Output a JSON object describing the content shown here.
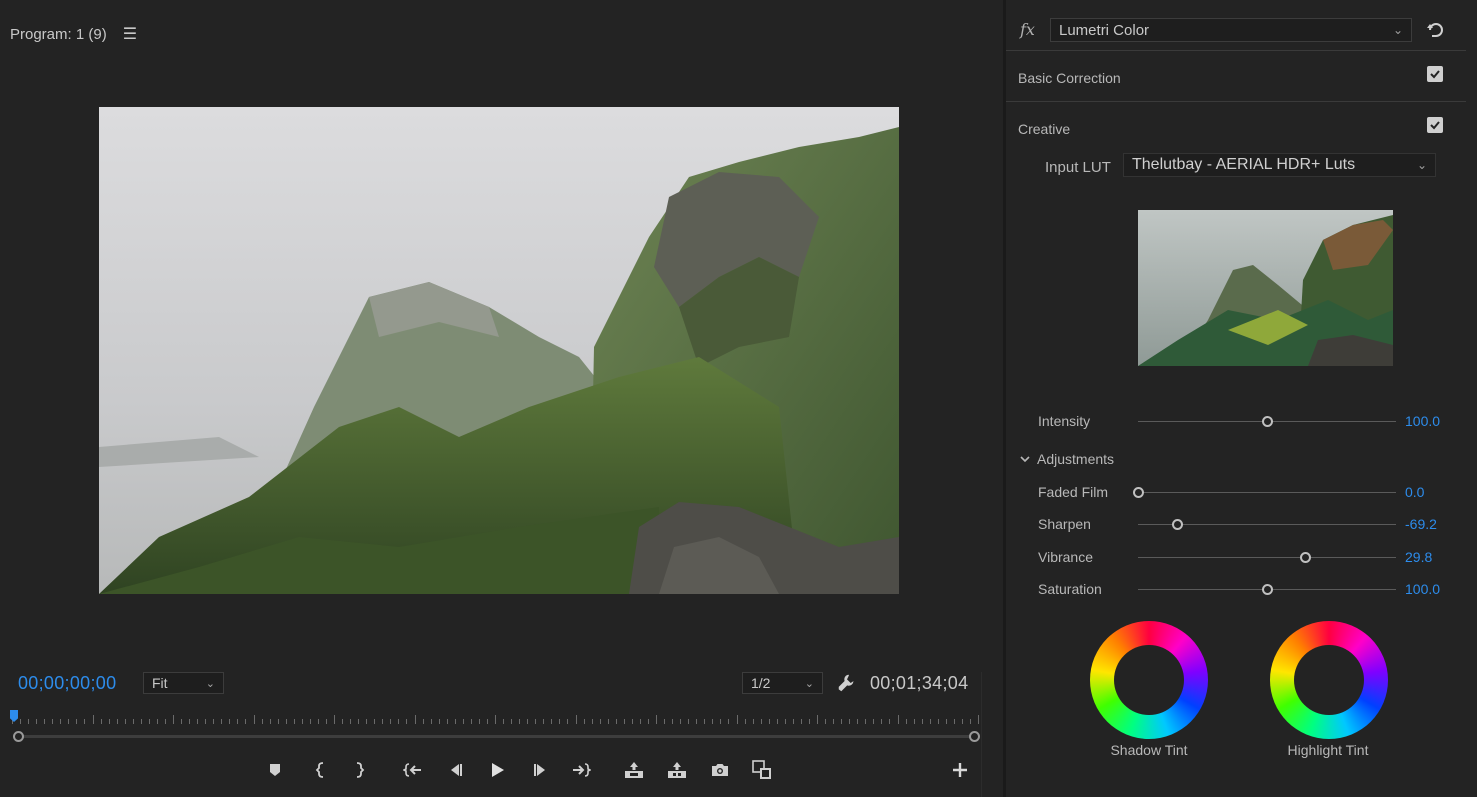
{
  "monitor": {
    "title": "Program: 1 (9)",
    "current_timecode": "00;00;00;00",
    "duration_timecode": "00;01;34;04",
    "fit": {
      "value": "Fit"
    },
    "resolution": {
      "value": "1/2"
    },
    "icons": {
      "menu": "hamburger-icon",
      "settings": "wrench-icon"
    },
    "transport": [
      "add-marker-icon",
      "mark-in-icon",
      "mark-out-icon",
      "go-to-in-icon",
      "step-back-icon",
      "play-icon",
      "step-forward-icon",
      "go-to-out-icon",
      "lift-icon",
      "extract-icon",
      "export-frame-icon",
      "comparison-view-icon"
    ],
    "add_button_icon": "plus-icon"
  },
  "lumetri": {
    "fx_label": "fx",
    "effect": "Lumetri Color",
    "basic_correction": {
      "label": "Basic Correction",
      "checked": true
    },
    "creative": {
      "label": "Creative",
      "checked": true
    },
    "input_lut": {
      "label": "Input LUT",
      "value": "Thelutbay - AERIAL HDR+ Luts"
    },
    "intensity": {
      "label": "Intensity",
      "value": "100.0",
      "fraction": 0.5
    },
    "adjustments": {
      "label": "Adjustments",
      "items": [
        {
          "label": "Faded Film",
          "value": "0.0",
          "fraction": 0.0
        },
        {
          "label": "Sharpen",
          "value": "-69.2",
          "fraction": 0.154
        },
        {
          "label": "Vibrance",
          "value": "29.8",
          "fraction": 0.65
        },
        {
          "label": "Saturation",
          "value": "100.0",
          "fraction": 0.5
        }
      ]
    },
    "wheels": {
      "shadow": "Shadow Tint",
      "highlight": "Highlight Tint"
    }
  }
}
